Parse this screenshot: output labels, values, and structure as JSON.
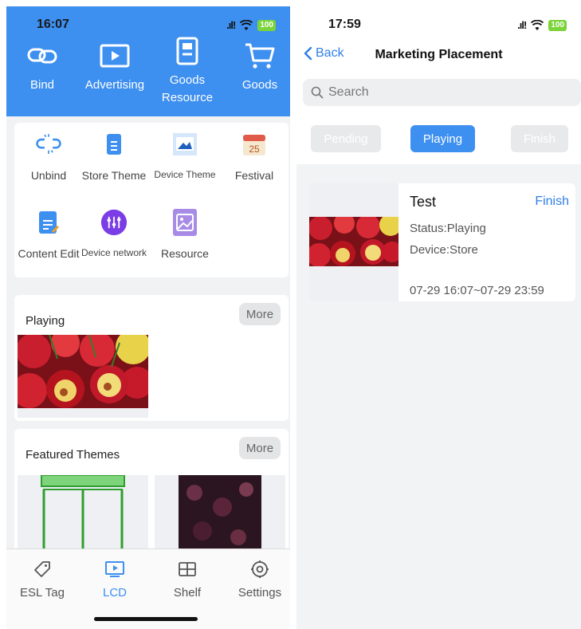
{
  "left": {
    "status": {
      "time": "16:07",
      "battery": "100"
    },
    "hero_items": [
      {
        "label": "Bind",
        "icon": "link-icon"
      },
      {
        "label": "Advertising",
        "icon": "play-screen-icon"
      },
      {
        "label": "Goods\nResource",
        "icon": "document-icon"
      },
      {
        "label": "Goods",
        "icon": "cart-icon"
      }
    ],
    "tools": [
      {
        "label": "Unbind",
        "icon": "unlink-icon"
      },
      {
        "label": "Store Theme",
        "icon": "store-theme-icon"
      },
      {
        "label": "Device Theme",
        "icon": "device-theme-icon"
      },
      {
        "label": "Festival",
        "icon": "calendar-icon",
        "badge": "25"
      },
      {
        "label": "Content Edit",
        "icon": "content-edit-icon"
      },
      {
        "label": "Device network",
        "icon": "network-icon"
      },
      {
        "label": "Resource",
        "icon": "image-icon"
      }
    ],
    "playing": {
      "title": "Playing",
      "more": "More"
    },
    "featured": {
      "title": "Featured Themes",
      "more": "More"
    },
    "tabs": [
      {
        "label": "ESL Tag",
        "icon": "tag-icon",
        "active": false
      },
      {
        "label": "LCD",
        "icon": "monitor-play-icon",
        "active": true
      },
      {
        "label": "Shelf",
        "icon": "shelf-icon",
        "active": false
      },
      {
        "label": "Settings",
        "icon": "gear-icon",
        "active": false
      }
    ]
  },
  "right": {
    "status": {
      "time": "17:59",
      "battery": "100"
    },
    "nav": {
      "back": "Back",
      "title": "Marketing Placement"
    },
    "search": {
      "placeholder": "Search"
    },
    "segments": [
      "Pending",
      "Playing",
      "Finish"
    ],
    "active_segment": "Playing",
    "item": {
      "name": "Test",
      "action": "Finish",
      "status": "Status:Playing",
      "device": "Device:Store",
      "range": "07-29 16:07~07-29 23:59"
    }
  },
  "colors": {
    "accent": "#3d8ff0",
    "link": "#2f7fe8",
    "battery": "#7ad43a"
  }
}
